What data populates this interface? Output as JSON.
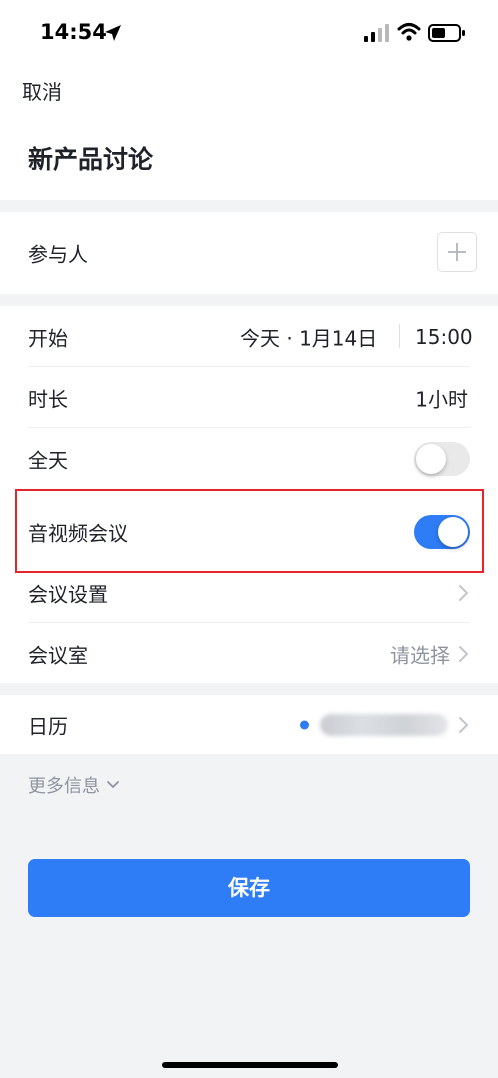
{
  "status": {
    "time": "14:54",
    "icons": [
      "location-arrow-icon",
      "cellular-signal-icon",
      "wifi-icon",
      "battery-icon"
    ]
  },
  "header": {
    "cancel_label": "取消",
    "title": "新产品讨论"
  },
  "participants": {
    "label": "参与人",
    "add_icon": "plus-icon"
  },
  "schedule": {
    "start_label": "开始",
    "start_date": "今天 · 1月14日",
    "start_time": "15:00",
    "duration_label": "时长",
    "duration_value": "1小时",
    "all_day_label": "全天",
    "all_day_on": false
  },
  "meeting": {
    "av_label": "音视频会议",
    "av_on": true,
    "settings_label": "会议设置",
    "room_label": "会议室",
    "room_placeholder": "请选择"
  },
  "calendar": {
    "label": "日历",
    "dot_color": "#2e7cf6"
  },
  "more_info_label": "更多信息",
  "save_label": "保存",
  "colors": {
    "accent": "#2e7cf6",
    "highlight": "#e4262b",
    "background": "#f2f3f5"
  }
}
